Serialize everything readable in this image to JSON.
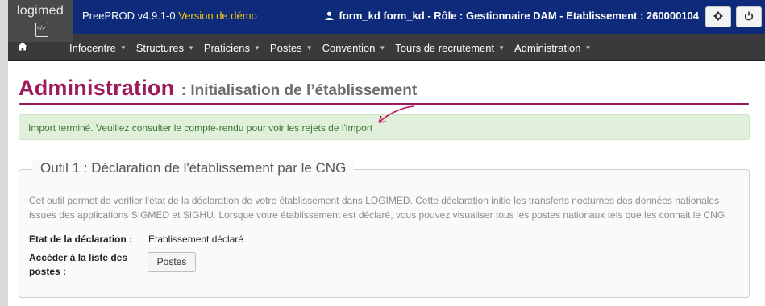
{
  "app": {
    "logo_text": "logimed",
    "env_label": "PreePROD v4.9.1-0",
    "env_demo": "Version de démo",
    "user_info": "form_kd form_kd - Rôle : Gestionnaire DAM - Etablissement : 260000104",
    "gear_icon": "gear-icon",
    "power_icon": "power-icon"
  },
  "nav": {
    "home_icon": "home-icon",
    "items": [
      {
        "label": "Infocentre"
      },
      {
        "label": "Structures"
      },
      {
        "label": "Praticiens"
      },
      {
        "label": "Postes"
      },
      {
        "label": "Convention"
      },
      {
        "label": "Tours de recrutement"
      },
      {
        "label": "Administration"
      }
    ]
  },
  "page": {
    "title": "Administration",
    "subtitle": ": Initialisation de l’établissement",
    "alert": "Import terminé. Veuillez consulter le compte-rendu pour voir les rejets de l'import"
  },
  "tool1": {
    "legend": "Outil 1 : Déclaration de l'établissement par le CNG",
    "description": "Cet outil permet de verifier l'état de la déclaration de votre établissement dans LOGIMED. Cette déclaration initie les transferts nocturnes des données nationales issues des applications SIGMED et SIGHU. Lorsque votre établissement est déclaré, vous pouvez visualiser tous les postes nationaux tels que les connait le CNG.",
    "state_label": "Etat de la déclaration :",
    "state_value": "Etablissement déclaré",
    "list_label": "Accèder à la liste des postes :",
    "postes_button": "Postes"
  },
  "colors": {
    "topbar": "#0d2b7a",
    "navbar": "#3a3a3a",
    "title_accent": "#9c1a5a",
    "alert_bg": "#e1f0da",
    "alert_text": "#3c763d",
    "demo_text": "#f2c811"
  }
}
